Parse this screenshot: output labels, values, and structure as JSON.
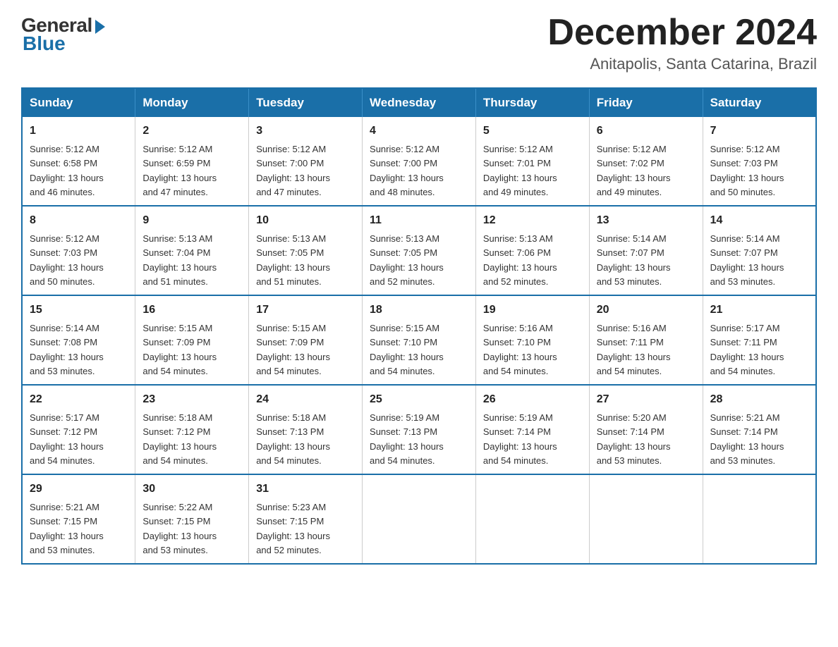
{
  "logo": {
    "general": "General",
    "blue": "Blue"
  },
  "title": "December 2024",
  "location": "Anitapolis, Santa Catarina, Brazil",
  "days_of_week": [
    "Sunday",
    "Monday",
    "Tuesday",
    "Wednesday",
    "Thursday",
    "Friday",
    "Saturday"
  ],
  "weeks": [
    [
      {
        "day": "1",
        "sunrise": "5:12 AM",
        "sunset": "6:58 PM",
        "daylight": "13 hours and 46 minutes."
      },
      {
        "day": "2",
        "sunrise": "5:12 AM",
        "sunset": "6:59 PM",
        "daylight": "13 hours and 47 minutes."
      },
      {
        "day": "3",
        "sunrise": "5:12 AM",
        "sunset": "7:00 PM",
        "daylight": "13 hours and 47 minutes."
      },
      {
        "day": "4",
        "sunrise": "5:12 AM",
        "sunset": "7:00 PM",
        "daylight": "13 hours and 48 minutes."
      },
      {
        "day": "5",
        "sunrise": "5:12 AM",
        "sunset": "7:01 PM",
        "daylight": "13 hours and 49 minutes."
      },
      {
        "day": "6",
        "sunrise": "5:12 AM",
        "sunset": "7:02 PM",
        "daylight": "13 hours and 49 minutes."
      },
      {
        "day": "7",
        "sunrise": "5:12 AM",
        "sunset": "7:03 PM",
        "daylight": "13 hours and 50 minutes."
      }
    ],
    [
      {
        "day": "8",
        "sunrise": "5:12 AM",
        "sunset": "7:03 PM",
        "daylight": "13 hours and 50 minutes."
      },
      {
        "day": "9",
        "sunrise": "5:13 AM",
        "sunset": "7:04 PM",
        "daylight": "13 hours and 51 minutes."
      },
      {
        "day": "10",
        "sunrise": "5:13 AM",
        "sunset": "7:05 PM",
        "daylight": "13 hours and 51 minutes."
      },
      {
        "day": "11",
        "sunrise": "5:13 AM",
        "sunset": "7:05 PM",
        "daylight": "13 hours and 52 minutes."
      },
      {
        "day": "12",
        "sunrise": "5:13 AM",
        "sunset": "7:06 PM",
        "daylight": "13 hours and 52 minutes."
      },
      {
        "day": "13",
        "sunrise": "5:14 AM",
        "sunset": "7:07 PM",
        "daylight": "13 hours and 53 minutes."
      },
      {
        "day": "14",
        "sunrise": "5:14 AM",
        "sunset": "7:07 PM",
        "daylight": "13 hours and 53 minutes."
      }
    ],
    [
      {
        "day": "15",
        "sunrise": "5:14 AM",
        "sunset": "7:08 PM",
        "daylight": "13 hours and 53 minutes."
      },
      {
        "day": "16",
        "sunrise": "5:15 AM",
        "sunset": "7:09 PM",
        "daylight": "13 hours and 54 minutes."
      },
      {
        "day": "17",
        "sunrise": "5:15 AM",
        "sunset": "7:09 PM",
        "daylight": "13 hours and 54 minutes."
      },
      {
        "day": "18",
        "sunrise": "5:15 AM",
        "sunset": "7:10 PM",
        "daylight": "13 hours and 54 minutes."
      },
      {
        "day": "19",
        "sunrise": "5:16 AM",
        "sunset": "7:10 PM",
        "daylight": "13 hours and 54 minutes."
      },
      {
        "day": "20",
        "sunrise": "5:16 AM",
        "sunset": "7:11 PM",
        "daylight": "13 hours and 54 minutes."
      },
      {
        "day": "21",
        "sunrise": "5:17 AM",
        "sunset": "7:11 PM",
        "daylight": "13 hours and 54 minutes."
      }
    ],
    [
      {
        "day": "22",
        "sunrise": "5:17 AM",
        "sunset": "7:12 PM",
        "daylight": "13 hours and 54 minutes."
      },
      {
        "day": "23",
        "sunrise": "5:18 AM",
        "sunset": "7:12 PM",
        "daylight": "13 hours and 54 minutes."
      },
      {
        "day": "24",
        "sunrise": "5:18 AM",
        "sunset": "7:13 PM",
        "daylight": "13 hours and 54 minutes."
      },
      {
        "day": "25",
        "sunrise": "5:19 AM",
        "sunset": "7:13 PM",
        "daylight": "13 hours and 54 minutes."
      },
      {
        "day": "26",
        "sunrise": "5:19 AM",
        "sunset": "7:14 PM",
        "daylight": "13 hours and 54 minutes."
      },
      {
        "day": "27",
        "sunrise": "5:20 AM",
        "sunset": "7:14 PM",
        "daylight": "13 hours and 53 minutes."
      },
      {
        "day": "28",
        "sunrise": "5:21 AM",
        "sunset": "7:14 PM",
        "daylight": "13 hours and 53 minutes."
      }
    ],
    [
      {
        "day": "29",
        "sunrise": "5:21 AM",
        "sunset": "7:15 PM",
        "daylight": "13 hours and 53 minutes."
      },
      {
        "day": "30",
        "sunrise": "5:22 AM",
        "sunset": "7:15 PM",
        "daylight": "13 hours and 53 minutes."
      },
      {
        "day": "31",
        "sunrise": "5:23 AM",
        "sunset": "7:15 PM",
        "daylight": "13 hours and 52 minutes."
      },
      null,
      null,
      null,
      null
    ]
  ]
}
